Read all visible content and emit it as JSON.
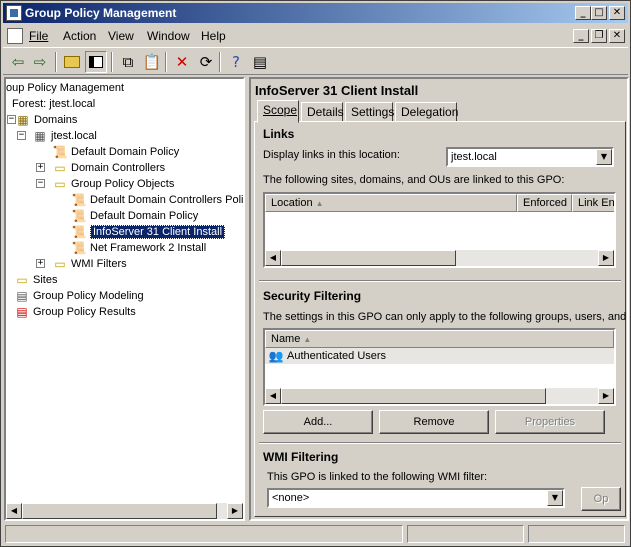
{
  "window": {
    "title": "Group Policy Management",
    "minimize": "_",
    "maximize": "□",
    "close": "✕"
  },
  "menu": {
    "items": [
      "File",
      "Action",
      "View",
      "Window",
      "Help"
    ],
    "mdi_minimize": "_",
    "mdi_restore": "❐",
    "mdi_close": "✕"
  },
  "toolbar": {
    "buttons": [
      "back-icon",
      "forward-icon",
      "up-folder-icon",
      "show-tree-icon",
      "copy-icon",
      "paste-icon",
      "delete-icon",
      "refresh-icon",
      "help-icon",
      "properties-icon"
    ]
  },
  "tree": {
    "items": [
      {
        "label": "oup Policy Management",
        "icon": "gpmc-icon"
      },
      {
        "label": "Forest: jtest.local",
        "icon": "forest-icon"
      },
      {
        "label": "Domains",
        "icon": "domains-icon"
      },
      {
        "label": "jtest.local",
        "icon": "domain-icon"
      },
      {
        "label": "Default Domain Policy",
        "icon": "gpo-link-icon"
      },
      {
        "label": "Domain Controllers",
        "icon": "ou-icon"
      },
      {
        "label": "Group Policy Objects",
        "icon": "gpo-folder-icon"
      },
      {
        "label": "Default Domain Controllers Polic",
        "icon": "gpo-icon"
      },
      {
        "label": "Default Domain Policy",
        "icon": "gpo-icon"
      },
      {
        "label": "InfoServer 31 Client Install",
        "icon": "gpo-icon"
      },
      {
        "label": "Net Framework 2 Install",
        "icon": "gpo-icon"
      },
      {
        "label": "WMI Filters",
        "icon": "wmi-folder-icon"
      },
      {
        "label": "Sites",
        "icon": "sites-icon"
      },
      {
        "label": "Group Policy Modeling",
        "icon": "modeling-icon"
      },
      {
        "label": "Group Policy Results",
        "icon": "results-icon"
      }
    ]
  },
  "details": {
    "title": "InfoServer 31 Client Install",
    "tabs": [
      "Scope",
      "Details",
      "Settings",
      "Delegation"
    ],
    "links": {
      "heading": "Links",
      "display_label": "Display links in this location:",
      "location_value": "jtest.local",
      "desc": "The following sites, domains, and OUs are linked to this GPO:",
      "columns": [
        "Location",
        "Enforced",
        "Link En"
      ]
    },
    "security": {
      "heading": "Security Filtering",
      "desc": "The settings in this GPO can only apply to the following groups, users, and",
      "column": "Name",
      "rows": [
        "Authenticated Users"
      ],
      "add": "Add...",
      "remove": "Remove",
      "properties": "Properties"
    },
    "wmi": {
      "heading": "WMI Filtering",
      "desc": "This GPO is linked to the following WMI filter:",
      "value": "<none>",
      "open": "Op"
    }
  },
  "colors": {
    "title_start": "#0a246a",
    "title_end": "#a6caf0",
    "selection": "#0a246a",
    "face": "#d4d0c8"
  }
}
